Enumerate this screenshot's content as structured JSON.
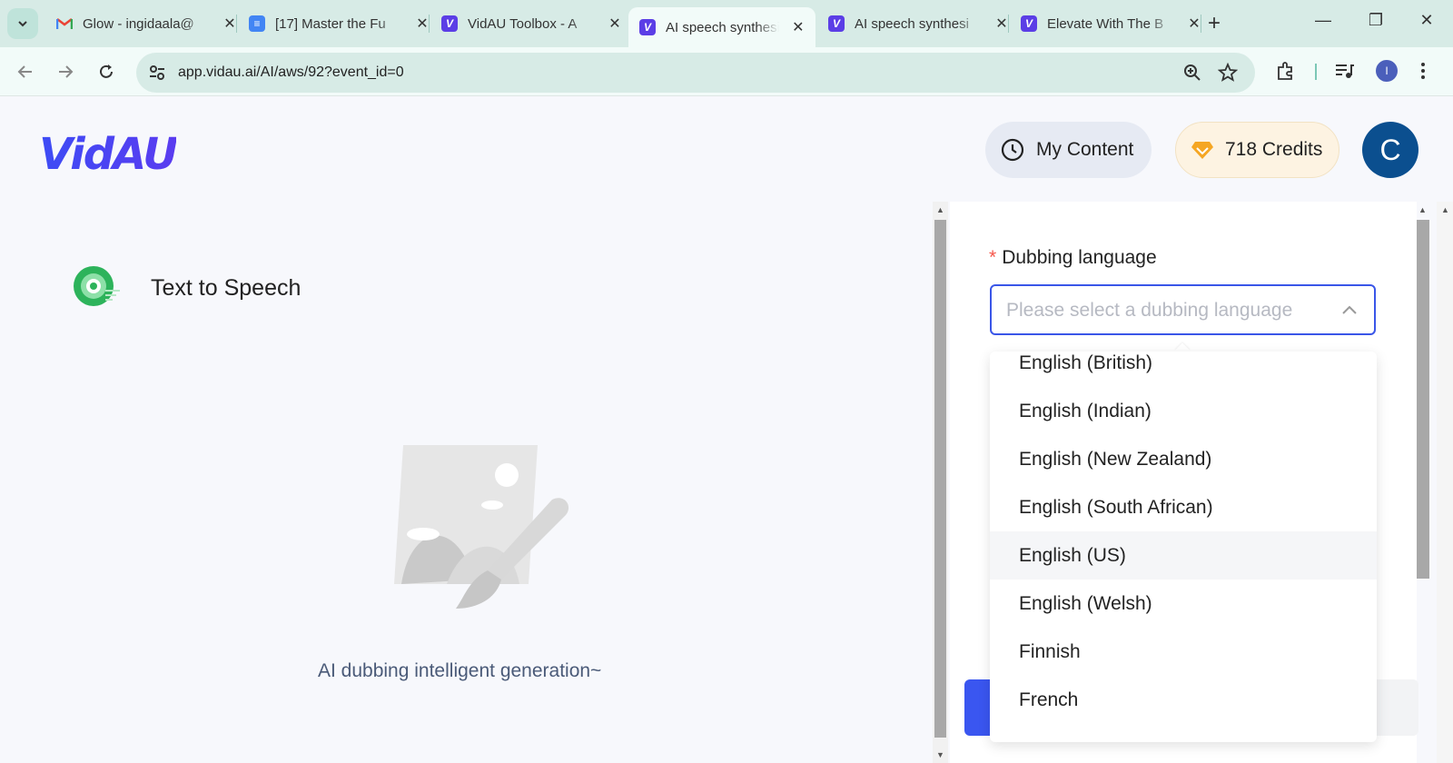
{
  "browser": {
    "tabs": [
      {
        "title": "Glow - ingidaala@",
        "favicon": "gmail-icon"
      },
      {
        "title": "[17] Master the Fu",
        "favicon": "docs-icon"
      },
      {
        "title": "VidAU Toolbox - A",
        "favicon": "vidau-icon"
      },
      {
        "title": "AI speech synthesi",
        "favicon": "vidau-icon",
        "active": true
      },
      {
        "title": "AI speech synthesi",
        "favicon": "vidau-icon"
      },
      {
        "title": "Elevate With The B",
        "favicon": "vidau-icon"
      }
    ],
    "url": "app.vidau.ai/AI/aws/92?event_id=0",
    "profile_initial": "I"
  },
  "header": {
    "logo": "VidAU",
    "my_content_label": "My Content",
    "credits_label": "718 Credits",
    "avatar_initial": "C"
  },
  "main": {
    "tool_title": "Text to Speech",
    "empty_text": "AI dubbing intelligent generation~"
  },
  "form": {
    "required_mark": "*",
    "language_label": "Dubbing language",
    "language_placeholder": "Please select a dubbing language",
    "options": [
      {
        "label": "English (British)"
      },
      {
        "label": "English (Indian)"
      },
      {
        "label": "English (New Zealand)"
      },
      {
        "label": "English (South African)"
      },
      {
        "label": "English (US)",
        "hovered": true
      },
      {
        "label": "English (Welsh)"
      },
      {
        "label": "Finnish"
      },
      {
        "label": "French"
      }
    ]
  },
  "colors": {
    "accent": "#3a56e8",
    "brand": "#4a45f2",
    "avatar_bg": "#0b4f8f",
    "credits_bg": "#fdf3e2"
  }
}
